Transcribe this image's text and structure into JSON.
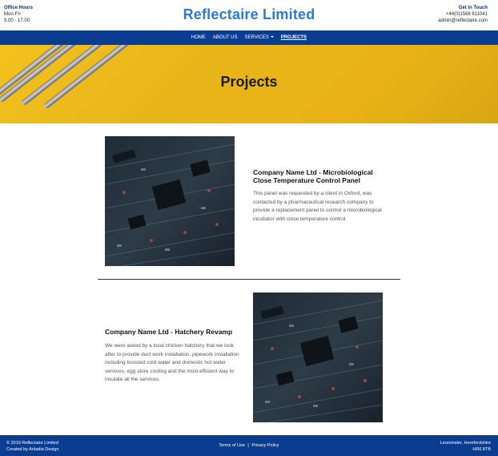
{
  "header": {
    "office_title": "Office Hours",
    "office_days": "Mon-Fri",
    "office_time": "9.00 - 17.00",
    "brand": "Reflectaire Limited",
    "contact_title": "Get In Touch",
    "contact_phone": "+44(0)1568 611041",
    "contact_email": "admin@reflectaire.com"
  },
  "nav": {
    "items": [
      {
        "label": "HOME"
      },
      {
        "label": "ABOUT US"
      },
      {
        "label": "SERVICES"
      },
      {
        "label": "PROJECTS"
      }
    ]
  },
  "hero": {
    "title": "Projects"
  },
  "projects": [
    {
      "title": "Company Name Ltd - Microbiological Close Temperature Control Panel",
      "description": "This panel was requested by a client in Oxford, was contacted by a pharmaceutical research company to provide a replacement panel to control a microbiological incubator with close temperature control."
    },
    {
      "title": "Company Name Ltd - Hatchery Revamp",
      "description": "We were asked by a local chicken hatchery that we look after to provide duct work installation, pipework installation including boosted cold water and domestic hot water services, egg store cooling and the most efficient way to insulate all the services."
    }
  ],
  "footer": {
    "copyright": "© 2019 Reflectaire Limited",
    "credit": "Created by Arkadia Design",
    "terms": "Terms of Use",
    "separator": "|",
    "privacy": "Privacy Policy",
    "location": "Leominster, Herefordshire",
    "postcode": "HR6 8TB"
  },
  "colors": {
    "nav_blue": "#0a3d8f",
    "brand_blue": "#2b7ad6",
    "hero_yellow": "#f2c21d"
  }
}
